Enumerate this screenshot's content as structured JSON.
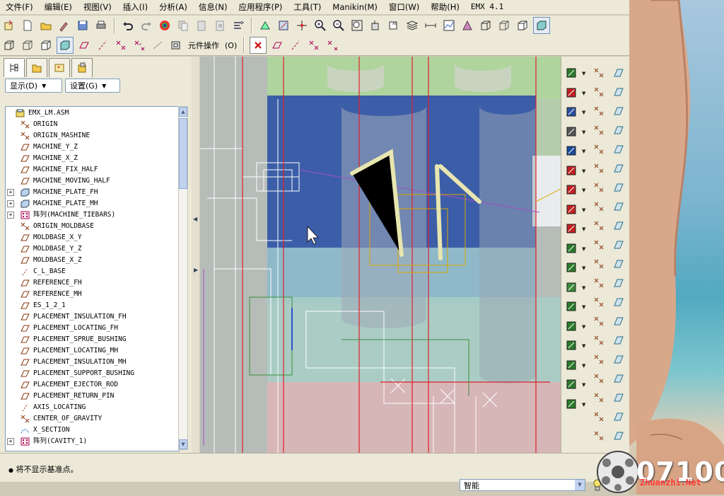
{
  "menubar": {
    "items": [
      "文件(F)",
      "编辑(E)",
      "视图(V)",
      "插入(I)",
      "分析(A)",
      "信息(N)",
      "应用程序(P)",
      "工具(T)",
      "Manikin(M)",
      "窗口(W)",
      "帮助(H)"
    ],
    "version": "EMX 4.1"
  },
  "toolbar2": {
    "component_ops_label": "元件操作"
  },
  "left_panel": {
    "display_dropdown": "显示",
    "settings_dropdown": "设置",
    "tree": [
      {
        "label": "EMX_LM.ASM",
        "icon": "assembly-icon",
        "expander": "",
        "indent": 0
      },
      {
        "label": "ORIGIN",
        "icon": "csys-icon",
        "expander": "",
        "indent": 1
      },
      {
        "label": "ORIGIN_MASHINE",
        "icon": "csys-icon",
        "expander": "",
        "indent": 1
      },
      {
        "label": "MACHINE_Y_Z",
        "icon": "datum-plane-icon",
        "expander": "",
        "indent": 1
      },
      {
        "label": "MACHINE_X_Z",
        "icon": "datum-plane-icon",
        "expander": "",
        "indent": 1
      },
      {
        "label": "MACHINE_FIX_HALF",
        "icon": "datum-plane-icon",
        "expander": "",
        "indent": 1
      },
      {
        "label": "MACHINE_MOVING_HALF",
        "icon": "datum-plane-icon",
        "expander": "",
        "indent": 1
      },
      {
        "label": "MACHINE_PLATE_FH",
        "icon": "part-icon",
        "expander": "+",
        "indent": 1
      },
      {
        "label": "MACHINE_PLATE_MH",
        "icon": "part-icon",
        "expander": "+",
        "indent": 1
      },
      {
        "label": "阵列(MACHINE_TIEBARS)",
        "icon": "pattern-icon",
        "expander": "+",
        "indent": 1
      },
      {
        "label": "ORIGIN_MOLDBASE",
        "icon": "csys-icon",
        "expander": "",
        "indent": 1
      },
      {
        "label": "MOLDBASE_X_Y",
        "icon": "datum-plane-icon",
        "expander": "",
        "indent": 1
      },
      {
        "label": "MOLDBASE_Y_Z",
        "icon": "datum-plane-icon",
        "expander": "",
        "indent": 1
      },
      {
        "label": "MOLDBASE_X_Z",
        "icon": "datum-plane-icon",
        "expander": "",
        "indent": 1
      },
      {
        "label": "C_L_BASE",
        "icon": "axis-icon",
        "expander": "",
        "indent": 1
      },
      {
        "label": "REFERENCE_FH",
        "icon": "datum-plane-icon",
        "expander": "",
        "indent": 1
      },
      {
        "label": "REFERENCE_MH",
        "icon": "datum-plane-icon",
        "expander": "",
        "indent": 1
      },
      {
        "label": "ES_1_2_1",
        "icon": "datum-plane-icon",
        "expander": "",
        "indent": 1
      },
      {
        "label": "PLACEMENT_INSULATION_FH",
        "icon": "datum-plane-icon",
        "expander": "",
        "indent": 1
      },
      {
        "label": "PLACEMENT_LOCATING_FH",
        "icon": "datum-plane-icon",
        "expander": "",
        "indent": 1
      },
      {
        "label": "PLACEMENT_SPRUE_BUSHING",
        "icon": "datum-plane-icon",
        "expander": "",
        "indent": 1
      },
      {
        "label": "PLACEMENT_LOCATING_MH",
        "icon": "datum-plane-icon",
        "expander": "",
        "indent": 1
      },
      {
        "label": "PLACEMENT_INSULATION_MH",
        "icon": "datum-plane-icon",
        "expander": "",
        "indent": 1
      },
      {
        "label": "PLACEMENT_SUPPORT_BUSHING",
        "icon": "datum-plane-icon",
        "expander": "",
        "indent": 1
      },
      {
        "label": "PLACEMENT_EJECTOR_ROD",
        "icon": "datum-plane-icon",
        "expander": "",
        "indent": 1
      },
      {
        "label": "PLACEMENT_RETURN_PIN",
        "icon": "datum-plane-icon",
        "expander": "",
        "indent": 1
      },
      {
        "label": "AXIS_LOCATING",
        "icon": "axis-icon",
        "expander": "",
        "indent": 1
      },
      {
        "label": "CENTER_OF_GRAVITY",
        "icon": "csys-icon",
        "expander": "",
        "indent": 1
      },
      {
        "label": "X_SECTION",
        "icon": "section-icon",
        "expander": "",
        "indent": 1
      },
      {
        "label": "阵列(CAVITY_1)",
        "icon": "pattern-icon",
        "expander": "+",
        "indent": 1
      }
    ]
  },
  "status": {
    "message": "将不显示基准点。",
    "filter": "智能"
  },
  "watermark": {
    "number": "07100",
    "site": "Zhuanzhi.Net"
  }
}
